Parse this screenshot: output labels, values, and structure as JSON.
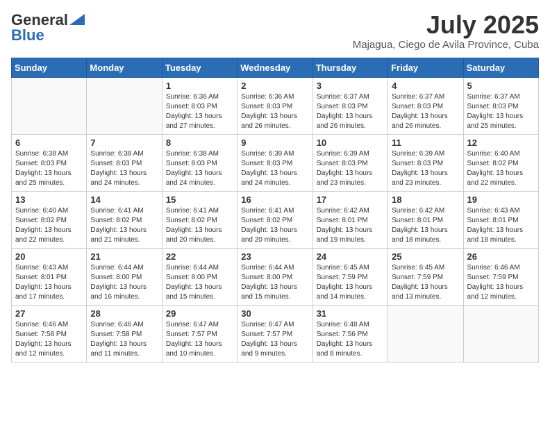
{
  "header": {
    "logo_general": "General",
    "logo_blue": "Blue",
    "month_title": "July 2025",
    "location": "Majagua, Ciego de Avila Province, Cuba"
  },
  "weekdays": [
    "Sunday",
    "Monday",
    "Tuesday",
    "Wednesday",
    "Thursday",
    "Friday",
    "Saturday"
  ],
  "weeks": [
    [
      {
        "day": "",
        "info": ""
      },
      {
        "day": "",
        "info": ""
      },
      {
        "day": "1",
        "info": "Sunrise: 6:36 AM\nSunset: 8:03 PM\nDaylight: 13 hours and 27 minutes."
      },
      {
        "day": "2",
        "info": "Sunrise: 6:36 AM\nSunset: 8:03 PM\nDaylight: 13 hours and 26 minutes."
      },
      {
        "day": "3",
        "info": "Sunrise: 6:37 AM\nSunset: 8:03 PM\nDaylight: 13 hours and 26 minutes."
      },
      {
        "day": "4",
        "info": "Sunrise: 6:37 AM\nSunset: 8:03 PM\nDaylight: 13 hours and 26 minutes."
      },
      {
        "day": "5",
        "info": "Sunrise: 6:37 AM\nSunset: 8:03 PM\nDaylight: 13 hours and 25 minutes."
      }
    ],
    [
      {
        "day": "6",
        "info": "Sunrise: 6:38 AM\nSunset: 8:03 PM\nDaylight: 13 hours and 25 minutes."
      },
      {
        "day": "7",
        "info": "Sunrise: 6:38 AM\nSunset: 8:03 PM\nDaylight: 13 hours and 24 minutes."
      },
      {
        "day": "8",
        "info": "Sunrise: 6:38 AM\nSunset: 8:03 PM\nDaylight: 13 hours and 24 minutes."
      },
      {
        "day": "9",
        "info": "Sunrise: 6:39 AM\nSunset: 8:03 PM\nDaylight: 13 hours and 24 minutes."
      },
      {
        "day": "10",
        "info": "Sunrise: 6:39 AM\nSunset: 8:03 PM\nDaylight: 13 hours and 23 minutes."
      },
      {
        "day": "11",
        "info": "Sunrise: 6:39 AM\nSunset: 8:03 PM\nDaylight: 13 hours and 23 minutes."
      },
      {
        "day": "12",
        "info": "Sunrise: 6:40 AM\nSunset: 8:02 PM\nDaylight: 13 hours and 22 minutes."
      }
    ],
    [
      {
        "day": "13",
        "info": "Sunrise: 6:40 AM\nSunset: 8:02 PM\nDaylight: 13 hours and 22 minutes."
      },
      {
        "day": "14",
        "info": "Sunrise: 6:41 AM\nSunset: 8:02 PM\nDaylight: 13 hours and 21 minutes."
      },
      {
        "day": "15",
        "info": "Sunrise: 6:41 AM\nSunset: 8:02 PM\nDaylight: 13 hours and 20 minutes."
      },
      {
        "day": "16",
        "info": "Sunrise: 6:41 AM\nSunset: 8:02 PM\nDaylight: 13 hours and 20 minutes."
      },
      {
        "day": "17",
        "info": "Sunrise: 6:42 AM\nSunset: 8:01 PM\nDaylight: 13 hours and 19 minutes."
      },
      {
        "day": "18",
        "info": "Sunrise: 6:42 AM\nSunset: 8:01 PM\nDaylight: 13 hours and 18 minutes."
      },
      {
        "day": "19",
        "info": "Sunrise: 6:43 AM\nSunset: 8:01 PM\nDaylight: 13 hours and 18 minutes."
      }
    ],
    [
      {
        "day": "20",
        "info": "Sunrise: 6:43 AM\nSunset: 8:01 PM\nDaylight: 13 hours and 17 minutes."
      },
      {
        "day": "21",
        "info": "Sunrise: 6:44 AM\nSunset: 8:00 PM\nDaylight: 13 hours and 16 minutes."
      },
      {
        "day": "22",
        "info": "Sunrise: 6:44 AM\nSunset: 8:00 PM\nDaylight: 13 hours and 15 minutes."
      },
      {
        "day": "23",
        "info": "Sunrise: 6:44 AM\nSunset: 8:00 PM\nDaylight: 13 hours and 15 minutes."
      },
      {
        "day": "24",
        "info": "Sunrise: 6:45 AM\nSunset: 7:59 PM\nDaylight: 13 hours and 14 minutes."
      },
      {
        "day": "25",
        "info": "Sunrise: 6:45 AM\nSunset: 7:59 PM\nDaylight: 13 hours and 13 minutes."
      },
      {
        "day": "26",
        "info": "Sunrise: 6:46 AM\nSunset: 7:59 PM\nDaylight: 13 hours and 12 minutes."
      }
    ],
    [
      {
        "day": "27",
        "info": "Sunrise: 6:46 AM\nSunset: 7:58 PM\nDaylight: 13 hours and 12 minutes."
      },
      {
        "day": "28",
        "info": "Sunrise: 6:46 AM\nSunset: 7:58 PM\nDaylight: 13 hours and 11 minutes."
      },
      {
        "day": "29",
        "info": "Sunrise: 6:47 AM\nSunset: 7:57 PM\nDaylight: 13 hours and 10 minutes."
      },
      {
        "day": "30",
        "info": "Sunrise: 6:47 AM\nSunset: 7:57 PM\nDaylight: 13 hours and 9 minutes."
      },
      {
        "day": "31",
        "info": "Sunrise: 6:48 AM\nSunset: 7:56 PM\nDaylight: 13 hours and 8 minutes."
      },
      {
        "day": "",
        "info": ""
      },
      {
        "day": "",
        "info": ""
      }
    ]
  ]
}
